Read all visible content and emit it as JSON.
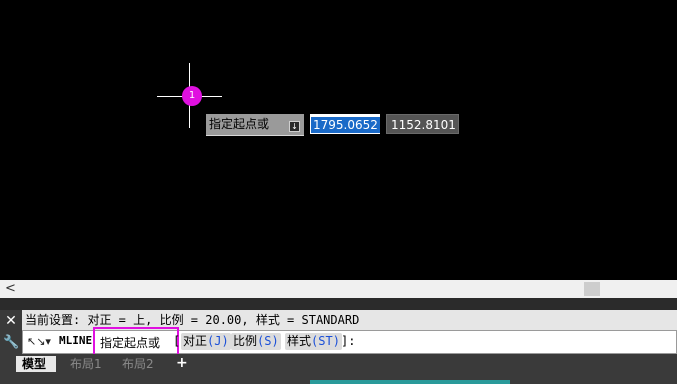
{
  "drawing": {
    "marker_label": "1",
    "prompt_label": "指定起点或",
    "prompt_arrow": "↓",
    "coord_x": "1795.0652",
    "coord_y": "1152.8101"
  },
  "scrollbar": {
    "left_arrow": "<"
  },
  "command": {
    "close_glyph": "✕",
    "wrench_glyph": "🔧",
    "history_text": "当前设置: 对正 = 上, 比例 = 20.00, 样式 = STANDARD",
    "cmd_icon": "↖↘▾",
    "cmd_name": "MLINE",
    "prompt": "指定起点或",
    "bracket_open": "[",
    "bracket_close": "]:",
    "options": [
      {
        "label": "对正",
        "key": "(J)"
      },
      {
        "label": "比例",
        "key": "(S)"
      },
      {
        "label": "样式",
        "key": "(ST)"
      }
    ]
  },
  "tabs": {
    "model": "模型",
    "layout1": "布局1",
    "layout2": "布局2",
    "add": "+"
  },
  "colors": {
    "highlight": "#e010e0",
    "selection": "#1a6ac8"
  }
}
